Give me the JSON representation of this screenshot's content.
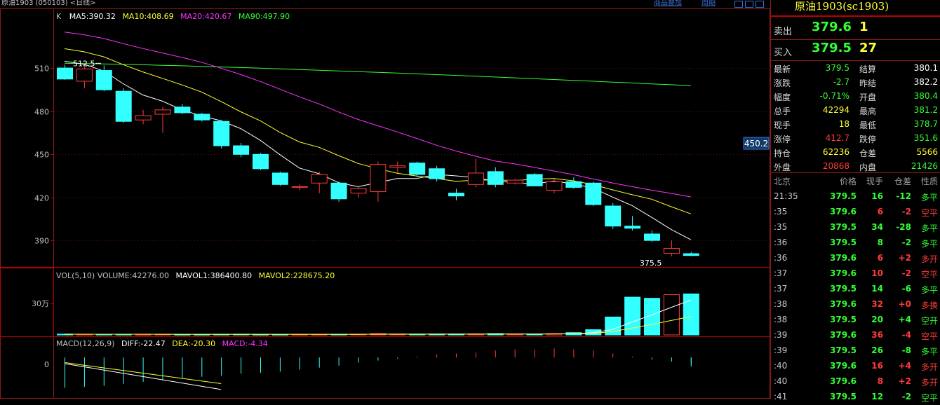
{
  "header": {
    "title": "原油1903 (050103) <日线>",
    "links": [
      "商品叠加",
      "周期"
    ]
  },
  "kline": {
    "label": "K",
    "ma": [
      {
        "name": "MA5:390.32",
        "color": "#ffffff"
      },
      {
        "name": "MA10:408.69",
        "color": "#ffff33"
      },
      {
        "name": "MA20:420.67",
        "color": "#ff33ff"
      },
      {
        "name": "MA90:497.90",
        "color": "#33ff33"
      }
    ],
    "yticks": [
      510,
      480,
      450,
      420,
      390
    ],
    "ylim": [
      372,
      541
    ],
    "high_label": "512.5",
    "low_label": "375.5",
    "crosshair_value": "450.2",
    "candles": [
      {
        "o": 510.2,
        "h": 512.5,
        "l": 502.0,
        "c": 502.5
      },
      {
        "o": 501.0,
        "h": 511.0,
        "l": 496.0,
        "c": 509.5
      },
      {
        "o": 508.5,
        "h": 512.0,
        "l": 494.0,
        "c": 495.0
      },
      {
        "o": 494.0,
        "h": 496.0,
        "l": 472.0,
        "c": 473.0
      },
      {
        "o": 474.0,
        "h": 481.0,
        "l": 471.0,
        "c": 477.0
      },
      {
        "o": 478.0,
        "h": 483.0,
        "l": 465.0,
        "c": 481.0
      },
      {
        "o": 483.0,
        "h": 485.0,
        "l": 478.0,
        "c": 479.0
      },
      {
        "o": 478.0,
        "h": 479.0,
        "l": 473.0,
        "c": 474.0
      },
      {
        "o": 473.0,
        "h": 474.0,
        "l": 454.0,
        "c": 456.0
      },
      {
        "o": 456.0,
        "h": 458.0,
        "l": 448.0,
        "c": 450.0
      },
      {
        "o": 450.0,
        "h": 451.0,
        "l": 439.0,
        "c": 440.0
      },
      {
        "o": 437.0,
        "h": 438.0,
        "l": 428.0,
        "c": 429.0
      },
      {
        "o": 427.0,
        "h": 429.0,
        "l": 425.0,
        "c": 427.5
      },
      {
        "o": 430.0,
        "h": 438.0,
        "l": 423.0,
        "c": 436.0
      },
      {
        "o": 430.0,
        "h": 431.0,
        "l": 417.0,
        "c": 419.0
      },
      {
        "o": 423.0,
        "h": 428.0,
        "l": 420.0,
        "c": 426.0
      },
      {
        "o": 424.0,
        "h": 445.0,
        "l": 417.0,
        "c": 443.0
      },
      {
        "o": 441.0,
        "h": 445.0,
        "l": 437.0,
        "c": 442.0
      },
      {
        "o": 444.0,
        "h": 445.0,
        "l": 434.0,
        "c": 436.0
      },
      {
        "o": 440.0,
        "h": 442.0,
        "l": 431.0,
        "c": 433.0
      },
      {
        "o": 423.0,
        "h": 426.0,
        "l": 418.0,
        "c": 421.0
      },
      {
        "o": 429.0,
        "h": 447.0,
        "l": 427.0,
        "c": 437.0
      },
      {
        "o": 438.0,
        "h": 441.0,
        "l": 427.0,
        "c": 429.0
      },
      {
        "o": 430.0,
        "h": 433.0,
        "l": 429.0,
        "c": 432.0
      },
      {
        "o": 436.0,
        "h": 437.0,
        "l": 428.0,
        "c": 428.0
      },
      {
        "o": 425.0,
        "h": 433.0,
        "l": 423.0,
        "c": 431.0
      },
      {
        "o": 431.0,
        "h": 434.0,
        "l": 426.0,
        "c": 427.0
      },
      {
        "o": 430.0,
        "h": 431.0,
        "l": 414.0,
        "c": 415.0
      },
      {
        "o": 414.0,
        "h": 416.0,
        "l": 398.0,
        "c": 400.0
      },
      {
        "o": 400.0,
        "h": 407.0,
        "l": 397.0,
        "c": 398.5
      },
      {
        "o": 394.5,
        "h": 397.0,
        "l": 389.0,
        "c": 390.0
      },
      {
        "o": 381.0,
        "h": 390.0,
        "l": 379.0,
        "c": 384.5
      },
      {
        "o": 380.8,
        "h": 382.0,
        "l": 379.0,
        "c": 379.5
      }
    ],
    "ma5": [
      null,
      null,
      null,
      null,
      null,
      null,
      null,
      null,
      null,
      null,
      null,
      null,
      null,
      null,
      null,
      null,
      null,
      null,
      null,
      null,
      null,
      null,
      null,
      null,
      null,
      null,
      null,
      null,
      null,
      null,
      null,
      null,
      390
    ],
    "ma10": [],
    "ma20": [],
    "ma90": []
  },
  "volume": {
    "label": "VOL(5,10) VOLUME:42276.00",
    "mavol1": "MAVOL1:386400.80",
    "mavol2": "MAVOL2:228675.20",
    "ytick": "30万",
    "values": [
      8000,
      7000,
      7000,
      7000,
      6000,
      7000,
      6000,
      6000,
      7000,
      8000,
      6000,
      6000,
      6000,
      6000,
      7000,
      8000,
      14000,
      8000,
      8000,
      9000,
      10000,
      9000,
      14000,
      9000,
      10000,
      14000,
      24000,
      55000,
      188000,
      396000,
      384000,
      422000,
      430000,
      42276
    ],
    "ylim": [
      0,
      470000
    ]
  },
  "macd": {
    "label": "MACD(12,26,9)",
    "diff": "DIFF:-22.47",
    "dea": "DEA:-20.30",
    "macd": "MACD:-4.34",
    "ytick": "0",
    "bars": [
      -30,
      -29,
      -28,
      -26,
      -24,
      -22,
      -20,
      -19,
      -18,
      -16,
      -15,
      -14,
      -12,
      -10,
      -8,
      -5,
      -3,
      -1,
      1,
      3,
      4,
      5,
      7,
      8,
      8,
      9,
      8,
      7,
      4,
      1,
      -2,
      -4,
      -6,
      -9
    ],
    "ylim": [
      -40,
      14
    ]
  },
  "panel": {
    "title": "原油1903(sc1903)",
    "ask": {
      "label": "卖出",
      "price": "379.6",
      "vol": "1"
    },
    "bid": {
      "label": "买入",
      "price": "379.5",
      "vol": "27"
    },
    "stats": [
      {
        "l1": "最新",
        "v1": "379.5",
        "c1": "grn",
        "l2": "结算",
        "v2": "380.1",
        "c2": "wht"
      },
      {
        "l1": "涨跌",
        "v1": "-2.7",
        "c1": "grn",
        "l2": "昨结",
        "v2": "382.2",
        "c2": "wht"
      },
      {
        "l1": "幅度",
        "v1": "-0.71%",
        "c1": "grn",
        "l2": "开盘",
        "v2": "380.4",
        "c2": "grn"
      },
      {
        "l1": "总手",
        "v1": "42294",
        "c1": "yel",
        "l2": "最高",
        "v2": "381.2",
        "c2": "grn"
      },
      {
        "l1": "现手",
        "v1": "18",
        "c1": "yel",
        "l2": "最低",
        "v2": "378.7",
        "c2": "grn"
      },
      {
        "l1": "涨停",
        "v1": "412.7",
        "c1": "red",
        "l2": "跌停",
        "v2": "351.6",
        "c2": "grn"
      },
      {
        "l1": "持仓",
        "v1": "62236",
        "c1": "yel",
        "l2": "仓差",
        "v2": "5566",
        "c2": "yel"
      },
      {
        "l1": "外盘",
        "v1": "20868",
        "c1": "red",
        "l2": "内盘",
        "v2": "21426",
        "c2": "grn"
      }
    ],
    "ticks_header": [
      "北京",
      "价格",
      "现手",
      "仓差",
      "性质"
    ],
    "ticks": [
      {
        "time": "21:35",
        "price": "379.5",
        "vol": "16",
        "vc": "grn",
        "chg": "-12",
        "cc": "grn",
        "nat": "多平",
        "nc": "grn"
      },
      {
        "time": ":35",
        "price": "379.6",
        "vol": "6",
        "vc": "red",
        "chg": "-2",
        "cc": "red",
        "nat": "空平",
        "nc": "red"
      },
      {
        "time": ":35",
        "price": "379.5",
        "vol": "34",
        "vc": "grn",
        "chg": "-28",
        "cc": "grn",
        "nat": "多平",
        "nc": "grn"
      },
      {
        "time": ":36",
        "price": "379.5",
        "vol": "8",
        "vc": "grn",
        "chg": "-2",
        "cc": "grn",
        "nat": "多平",
        "nc": "grn"
      },
      {
        "time": ":36",
        "price": "379.6",
        "vol": "6",
        "vc": "red",
        "chg": "+2",
        "cc": "red",
        "nat": "多开",
        "nc": "red"
      },
      {
        "time": ":37",
        "price": "379.6",
        "vol": "10",
        "vc": "red",
        "chg": "-2",
        "cc": "red",
        "nat": "空平",
        "nc": "red"
      },
      {
        "time": ":37",
        "price": "379.5",
        "vol": "14",
        "vc": "grn",
        "chg": "-6",
        "cc": "grn",
        "nat": "多平",
        "nc": "grn"
      },
      {
        "time": ":38",
        "price": "379.6",
        "vol": "32",
        "vc": "red",
        "chg": "+0",
        "cc": "red",
        "nat": "多换",
        "nc": "red"
      },
      {
        "time": ":38",
        "price": "379.5",
        "vol": "20",
        "vc": "grn",
        "chg": "+4",
        "cc": "grn",
        "nat": "空开",
        "nc": "grn"
      },
      {
        "time": ":39",
        "price": "379.6",
        "vol": "36",
        "vc": "red",
        "chg": "-4",
        "cc": "red",
        "nat": "空平",
        "nc": "red"
      },
      {
        "time": ":39",
        "price": "379.5",
        "vol": "26",
        "vc": "grn",
        "chg": "-8",
        "cc": "grn",
        "nat": "多平",
        "nc": "grn"
      },
      {
        "time": ":40",
        "price": "379.6",
        "vol": "16",
        "vc": "red",
        "chg": "+4",
        "cc": "red",
        "nat": "多开",
        "nc": "red"
      },
      {
        "time": ":40",
        "price": "379.6",
        "vol": "8",
        "vc": "red",
        "chg": "+2",
        "cc": "red",
        "nat": "多开",
        "nc": "red"
      },
      {
        "time": ":41",
        "price": "379.5",
        "vol": "12",
        "vc": "grn",
        "chg": "-2",
        "cc": "grn",
        "nat": "空平",
        "nc": "grn"
      }
    ]
  }
}
